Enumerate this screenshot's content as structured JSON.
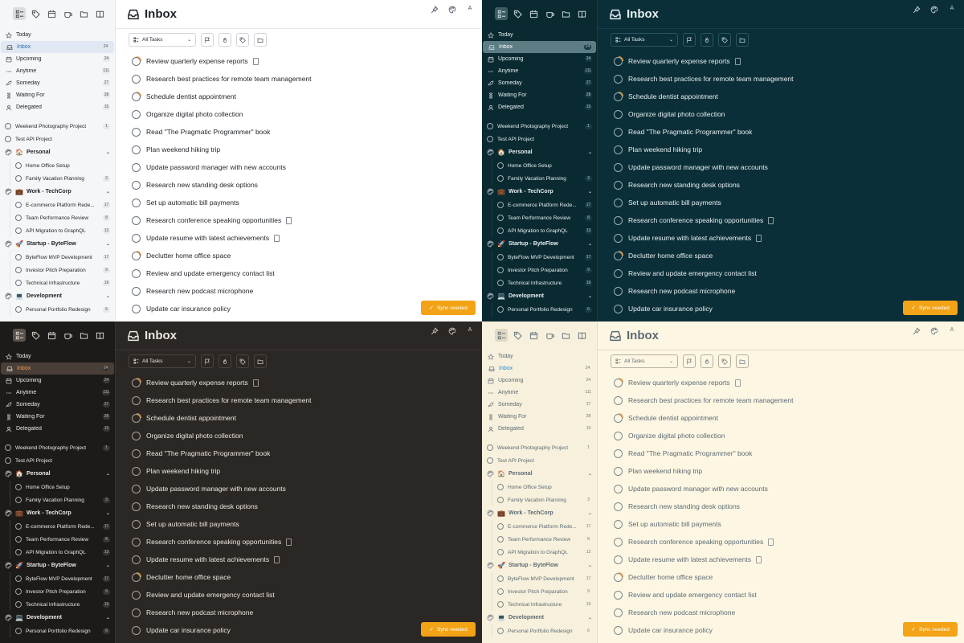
{
  "themes": [
    {
      "id": "light",
      "class": "t-light"
    },
    {
      "id": "teal",
      "class": "t-teal"
    },
    {
      "id": "dark",
      "class": "t-dark"
    },
    {
      "id": "cream",
      "class": "t-cream"
    }
  ],
  "toolbar_icons": [
    "list-icon",
    "tag-icon",
    "calendar-icon",
    "coffee-icon",
    "folder-icon",
    "book-icon"
  ],
  "nav": [
    {
      "label": "Today",
      "icon": "star-icon",
      "count": ""
    },
    {
      "label": "Inbox",
      "icon": "inbox-icon",
      "count": "24",
      "selected": true
    },
    {
      "label": "Upcoming",
      "icon": "calendar-icon",
      "count": "24"
    },
    {
      "label": "Anytime",
      "icon": "dots-icon",
      "count": "111"
    },
    {
      "label": "Someday",
      "icon": "rocket-icon",
      "count": "27"
    },
    {
      "label": "Waiting For",
      "icon": "hourglass-icon",
      "count": "28"
    },
    {
      "label": "Delegated",
      "icon": "person-icon",
      "count": "15"
    }
  ],
  "loose_projects": [
    {
      "label": "Weekend Photography Project",
      "count": "1"
    },
    {
      "label": "Test API Project",
      "count": ""
    }
  ],
  "areas": [
    {
      "label": "Personal",
      "emoji": "🏠",
      "projects": [
        {
          "label": "Home Office Setup",
          "count": ""
        },
        {
          "label": "Family Vacation Planning",
          "count": "3"
        }
      ]
    },
    {
      "label": "Work - TechCorp",
      "emoji": "💼",
      "projects": [
        {
          "label": "E-commerce Platform Rede...",
          "count": "17"
        },
        {
          "label": "Team Performance Review",
          "count": "8"
        },
        {
          "label": "API Migration to GraphQL",
          "count": "13"
        }
      ]
    },
    {
      "label": "Startup - ByteFlow",
      "emoji": "🚀",
      "projects": [
        {
          "label": "ByteFlow MVP Development",
          "count": "17"
        },
        {
          "label": "Investor Pitch Preparation",
          "count": "9"
        },
        {
          "label": "Technical Infrastructure",
          "count": "19"
        }
      ]
    },
    {
      "label": "Development",
      "emoji": "💻",
      "projects": [
        {
          "label": "Personal Portfolio Redesign",
          "count": "6"
        }
      ]
    }
  ],
  "header": {
    "title": "Inbox",
    "top_icons": [
      "pin-icon",
      "palette-icon",
      "font-icon"
    ],
    "font_icon_text": "A"
  },
  "filter": {
    "label": "All Tasks",
    "buttons": [
      "flag-icon",
      "flame-icon",
      "tag-icon",
      "folder-icon"
    ]
  },
  "tasks": [
    {
      "label": "Review quarterly expense reports",
      "progress": true,
      "note": true
    },
    {
      "label": "Research best practices for remote team management",
      "progress": false,
      "note": false
    },
    {
      "label": "Schedule dentist appointment",
      "progress": true,
      "note": false
    },
    {
      "label": "Organize digital photo collection",
      "progress": false,
      "note": false
    },
    {
      "label": "Read \"The Pragmatic Programmer\" book",
      "progress": false,
      "note": false
    },
    {
      "label": "Plan weekend hiking trip",
      "progress": false,
      "note": false
    },
    {
      "label": "Update password manager with new accounts",
      "progress": false,
      "note": false
    },
    {
      "label": "Research new standing desk options",
      "progress": false,
      "note": false
    },
    {
      "label": "Set up automatic bill payments",
      "progress": false,
      "note": false
    },
    {
      "label": "Research conference speaking opportunities",
      "progress": false,
      "note": true
    },
    {
      "label": "Update resume with latest achievements",
      "progress": false,
      "note": true
    },
    {
      "label": "Declutter home office space",
      "progress": true,
      "note": false
    },
    {
      "label": "Review and update emergency contact list",
      "progress": false,
      "note": false
    },
    {
      "label": "Research new podcast microphone",
      "progress": false,
      "note": false
    },
    {
      "label": "Update car insurance policy",
      "progress": false,
      "note": false
    }
  ],
  "sync": {
    "label": "Sync needed"
  },
  "colors": {
    "sync": "#f2a316",
    "progress": "#f39a2e"
  }
}
